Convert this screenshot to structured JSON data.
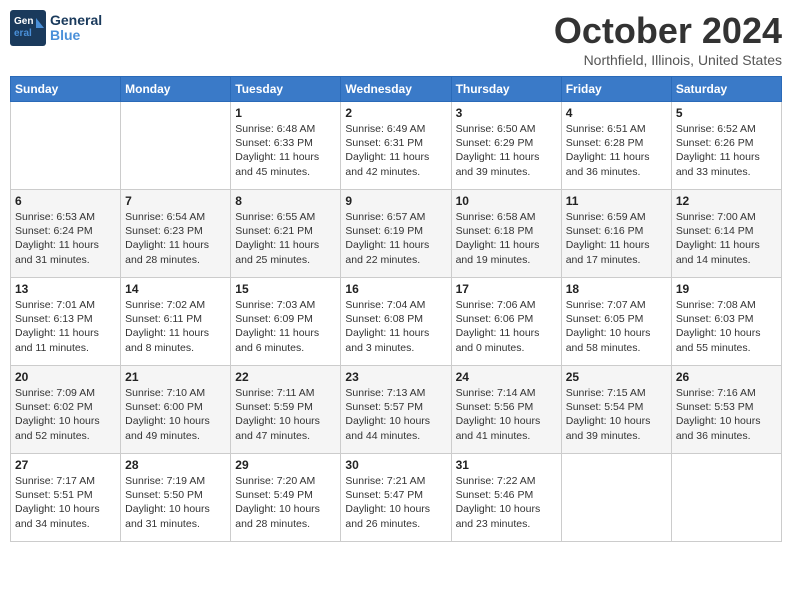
{
  "header": {
    "logo_line1": "General",
    "logo_line2": "Blue",
    "month": "October 2024",
    "location": "Northfield, Illinois, United States"
  },
  "days_of_week": [
    "Sunday",
    "Monday",
    "Tuesday",
    "Wednesday",
    "Thursday",
    "Friday",
    "Saturday"
  ],
  "weeks": [
    [
      {
        "day": "",
        "info": ""
      },
      {
        "day": "",
        "info": ""
      },
      {
        "day": "1",
        "info": "Sunrise: 6:48 AM\nSunset: 6:33 PM\nDaylight: 11 hours and 45 minutes."
      },
      {
        "day": "2",
        "info": "Sunrise: 6:49 AM\nSunset: 6:31 PM\nDaylight: 11 hours and 42 minutes."
      },
      {
        "day": "3",
        "info": "Sunrise: 6:50 AM\nSunset: 6:29 PM\nDaylight: 11 hours and 39 minutes."
      },
      {
        "day": "4",
        "info": "Sunrise: 6:51 AM\nSunset: 6:28 PM\nDaylight: 11 hours and 36 minutes."
      },
      {
        "day": "5",
        "info": "Sunrise: 6:52 AM\nSunset: 6:26 PM\nDaylight: 11 hours and 33 minutes."
      }
    ],
    [
      {
        "day": "6",
        "info": "Sunrise: 6:53 AM\nSunset: 6:24 PM\nDaylight: 11 hours and 31 minutes."
      },
      {
        "day": "7",
        "info": "Sunrise: 6:54 AM\nSunset: 6:23 PM\nDaylight: 11 hours and 28 minutes."
      },
      {
        "day": "8",
        "info": "Sunrise: 6:55 AM\nSunset: 6:21 PM\nDaylight: 11 hours and 25 minutes."
      },
      {
        "day": "9",
        "info": "Sunrise: 6:57 AM\nSunset: 6:19 PM\nDaylight: 11 hours and 22 minutes."
      },
      {
        "day": "10",
        "info": "Sunrise: 6:58 AM\nSunset: 6:18 PM\nDaylight: 11 hours and 19 minutes."
      },
      {
        "day": "11",
        "info": "Sunrise: 6:59 AM\nSunset: 6:16 PM\nDaylight: 11 hours and 17 minutes."
      },
      {
        "day": "12",
        "info": "Sunrise: 7:00 AM\nSunset: 6:14 PM\nDaylight: 11 hours and 14 minutes."
      }
    ],
    [
      {
        "day": "13",
        "info": "Sunrise: 7:01 AM\nSunset: 6:13 PM\nDaylight: 11 hours and 11 minutes."
      },
      {
        "day": "14",
        "info": "Sunrise: 7:02 AM\nSunset: 6:11 PM\nDaylight: 11 hours and 8 minutes."
      },
      {
        "day": "15",
        "info": "Sunrise: 7:03 AM\nSunset: 6:09 PM\nDaylight: 11 hours and 6 minutes."
      },
      {
        "day": "16",
        "info": "Sunrise: 7:04 AM\nSunset: 6:08 PM\nDaylight: 11 hours and 3 minutes."
      },
      {
        "day": "17",
        "info": "Sunrise: 7:06 AM\nSunset: 6:06 PM\nDaylight: 11 hours and 0 minutes."
      },
      {
        "day": "18",
        "info": "Sunrise: 7:07 AM\nSunset: 6:05 PM\nDaylight: 10 hours and 58 minutes."
      },
      {
        "day": "19",
        "info": "Sunrise: 7:08 AM\nSunset: 6:03 PM\nDaylight: 10 hours and 55 minutes."
      }
    ],
    [
      {
        "day": "20",
        "info": "Sunrise: 7:09 AM\nSunset: 6:02 PM\nDaylight: 10 hours and 52 minutes."
      },
      {
        "day": "21",
        "info": "Sunrise: 7:10 AM\nSunset: 6:00 PM\nDaylight: 10 hours and 49 minutes."
      },
      {
        "day": "22",
        "info": "Sunrise: 7:11 AM\nSunset: 5:59 PM\nDaylight: 10 hours and 47 minutes."
      },
      {
        "day": "23",
        "info": "Sunrise: 7:13 AM\nSunset: 5:57 PM\nDaylight: 10 hours and 44 minutes."
      },
      {
        "day": "24",
        "info": "Sunrise: 7:14 AM\nSunset: 5:56 PM\nDaylight: 10 hours and 41 minutes."
      },
      {
        "day": "25",
        "info": "Sunrise: 7:15 AM\nSunset: 5:54 PM\nDaylight: 10 hours and 39 minutes."
      },
      {
        "day": "26",
        "info": "Sunrise: 7:16 AM\nSunset: 5:53 PM\nDaylight: 10 hours and 36 minutes."
      }
    ],
    [
      {
        "day": "27",
        "info": "Sunrise: 7:17 AM\nSunset: 5:51 PM\nDaylight: 10 hours and 34 minutes."
      },
      {
        "day": "28",
        "info": "Sunrise: 7:19 AM\nSunset: 5:50 PM\nDaylight: 10 hours and 31 minutes."
      },
      {
        "day": "29",
        "info": "Sunrise: 7:20 AM\nSunset: 5:49 PM\nDaylight: 10 hours and 28 minutes."
      },
      {
        "day": "30",
        "info": "Sunrise: 7:21 AM\nSunset: 5:47 PM\nDaylight: 10 hours and 26 minutes."
      },
      {
        "day": "31",
        "info": "Sunrise: 7:22 AM\nSunset: 5:46 PM\nDaylight: 10 hours and 23 minutes."
      },
      {
        "day": "",
        "info": ""
      },
      {
        "day": "",
        "info": ""
      }
    ]
  ]
}
